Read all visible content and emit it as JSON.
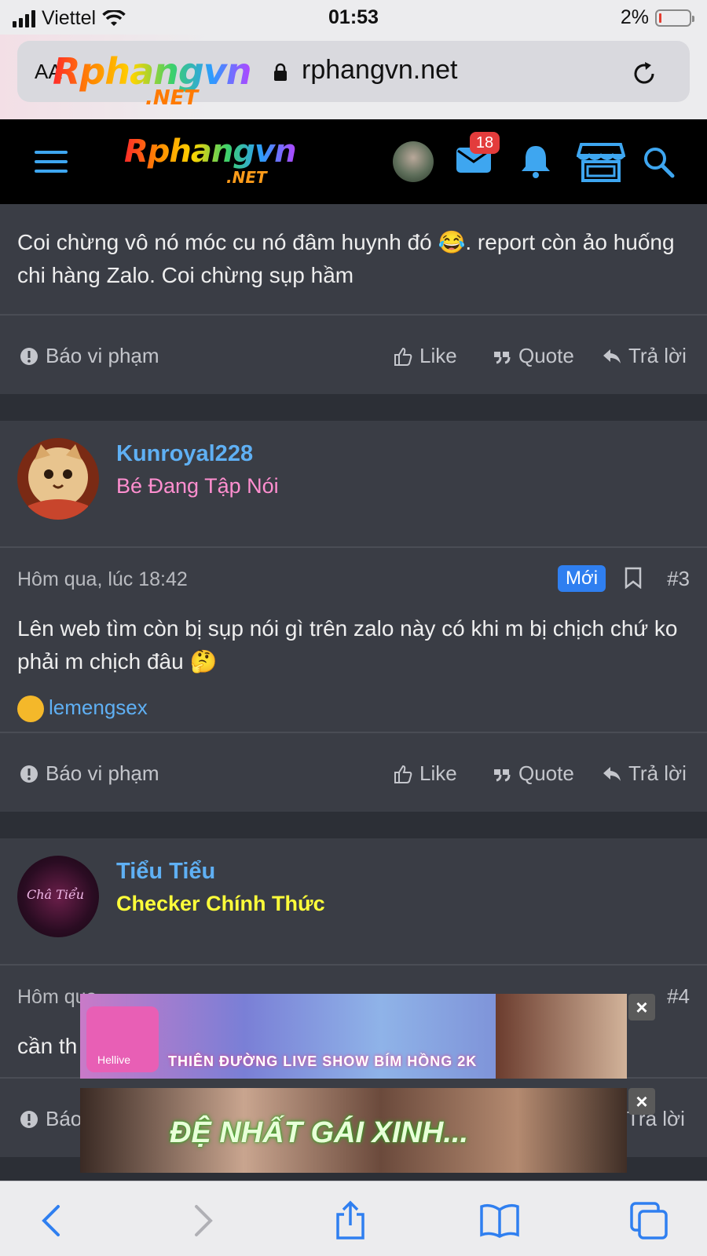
{
  "status_bar": {
    "carrier": "Viettel",
    "time": "01:53",
    "battery": "2%"
  },
  "browser": {
    "text_size_label": "AA",
    "url": "rphangvn.net",
    "overlay_logo_text": "Rphangvn",
    "overlay_logo_sub": ".NET"
  },
  "header": {
    "logo_text": "Rphangvn",
    "logo_sub": ".NET",
    "messages_count": "18"
  },
  "posts": [
    {
      "id": "partial",
      "body": "Coi chừng vô nó móc cu nó đâm huynh đó 😂. report còn ảo huống chi hàng Zalo. Coi chừng sụp hầm",
      "actions": {
        "report": "Báo vi phạm",
        "like": "Like",
        "quote": "Quote",
        "reply": "Trả lời"
      }
    },
    {
      "id": "post3",
      "username": "Kunroyal228",
      "user_title": "Bé Đang Tập Nói",
      "user_title_color": "#ff8fd0",
      "time": "Hôm qua, lúc 18:42",
      "badge": "Mới",
      "number": "#3",
      "body": "Lên web tìm còn bị sụp nói gì trên zalo này có khi m bị chịch chứ ko phải m chịch đâu 🤔",
      "reaction_user": "lemengsex",
      "actions": {
        "report": "Báo vi phạm",
        "like": "Like",
        "quote": "Quote",
        "reply": "Trả lời"
      }
    },
    {
      "id": "post4",
      "username": "Tiểu Tiểu",
      "user_title": "Checker Chính Thức",
      "user_title_color": "#ffff3a",
      "avatar_text": "Châ Tiểu",
      "time": "Hôm qua",
      "number": "#4",
      "body": "cần th",
      "actions": {
        "report": "Báo",
        "reply": "Trả lời"
      }
    }
  ],
  "ads": [
    {
      "text": "THIÊN ĐƯỜNG LIVE SHOW BÍM HỒNG 2K",
      "brand": "Hellive"
    },
    {
      "text": "ĐỆ NHẤT GÁI XINH..."
    }
  ],
  "colors": {
    "accent": "#3ea6f0",
    "username": "#5fb0f4",
    "badge": "#2f7ff0",
    "background": "#2c2f36",
    "card": "#3a3d45"
  }
}
